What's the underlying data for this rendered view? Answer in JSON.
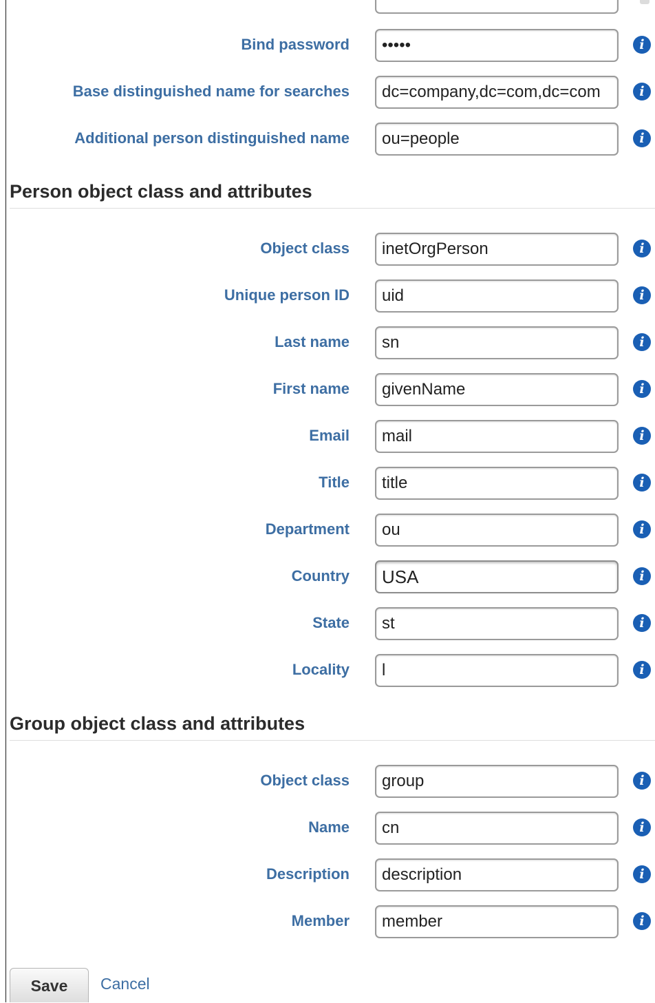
{
  "connection_fields": [
    {
      "label": "Bind password",
      "value": "•••••"
    },
    {
      "label": "Base distinguished name for searches",
      "value": "dc=company,dc=com,dc=com"
    },
    {
      "label": "Additional person distinguished name",
      "value": "ou=people"
    }
  ],
  "person_section": {
    "title": "Person object class and attributes",
    "fields": [
      {
        "label": "Object class",
        "value": "inetOrgPerson"
      },
      {
        "label": "Unique person ID",
        "value": "uid"
      },
      {
        "label": "Last name",
        "value": "sn"
      },
      {
        "label": "First name",
        "value": "givenName"
      },
      {
        "label": "Email",
        "value": "mail"
      },
      {
        "label": "Title",
        "value": "title"
      },
      {
        "label": "Department",
        "value": "ou"
      },
      {
        "label": "Country",
        "value": "USA"
      },
      {
        "label": "State",
        "value": "st"
      },
      {
        "label": "Locality",
        "value": "l"
      }
    ]
  },
  "group_section": {
    "title": "Group object class and attributes",
    "fields": [
      {
        "label": "Object class",
        "value": "group"
      },
      {
        "label": "Name",
        "value": "cn"
      },
      {
        "label": "Description",
        "value": "description"
      },
      {
        "label": "Member",
        "value": "member"
      }
    ]
  },
  "actions": {
    "save": "Save",
    "cancel": "Cancel"
  },
  "info_icon": "i",
  "colors": {
    "label": "#3d6ea3",
    "info": "#1a5fb4",
    "heading": "#2b2b2b"
  }
}
